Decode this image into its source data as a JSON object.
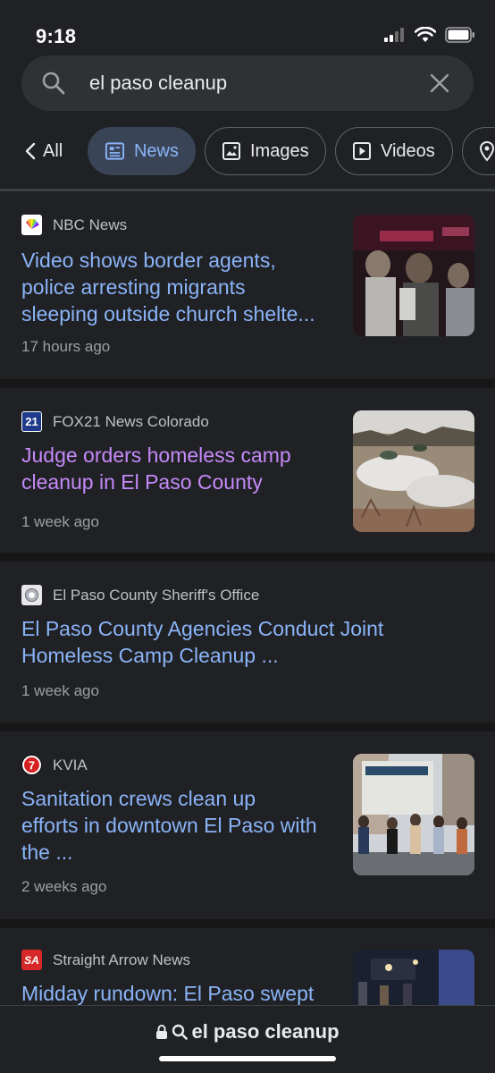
{
  "status_bar": {
    "time": "9:18"
  },
  "search": {
    "query": "el paso cleanup"
  },
  "filters": {
    "back_label": "All",
    "chips": [
      {
        "label": "News",
        "icon": "newspaper-icon",
        "active": true
      },
      {
        "label": "Images",
        "icon": "image-icon",
        "active": false
      },
      {
        "label": "Videos",
        "icon": "play-icon",
        "active": false
      },
      {
        "label": "",
        "icon": "map-pin-icon",
        "active": false
      }
    ]
  },
  "results": [
    {
      "source": "NBC News",
      "headline_lines": [
        "Video shows border agents,",
        "police arresting migrants",
        "sleeping outside church shelte..."
      ],
      "time": "17 hours ago",
      "has_thumbnail": true
    },
    {
      "source": "FOX21 News Colorado",
      "headline_lines": [
        "Judge orders homeless camp",
        "cleanup in El Paso County"
      ],
      "time": "1 week ago",
      "has_thumbnail": true,
      "visited": true
    },
    {
      "source": "El Paso County Sheriff's Office",
      "headline_lines": [
        "El Paso County Agencies Conduct Joint",
        "Homeless Camp Cleanup ..."
      ],
      "time": "1 week ago",
      "has_thumbnail": false
    },
    {
      "source": "KVIA",
      "headline_lines": [
        "Sanitation crews clean up",
        "efforts in downtown El Paso with",
        "the ..."
      ],
      "time": "2 weeks ago",
      "has_thumbnail": true
    },
    {
      "source": "Straight Arrow News",
      "headline_lines": [
        "Midday rundown: El Paso swept"
      ],
      "time": "",
      "has_thumbnail": true
    }
  ],
  "bottom_bar": {
    "url": "el paso cleanup"
  },
  "colors": {
    "link": "#8ab4f8",
    "visited": "#c58af9",
    "background": "#202124",
    "chip_active": "#394457"
  }
}
